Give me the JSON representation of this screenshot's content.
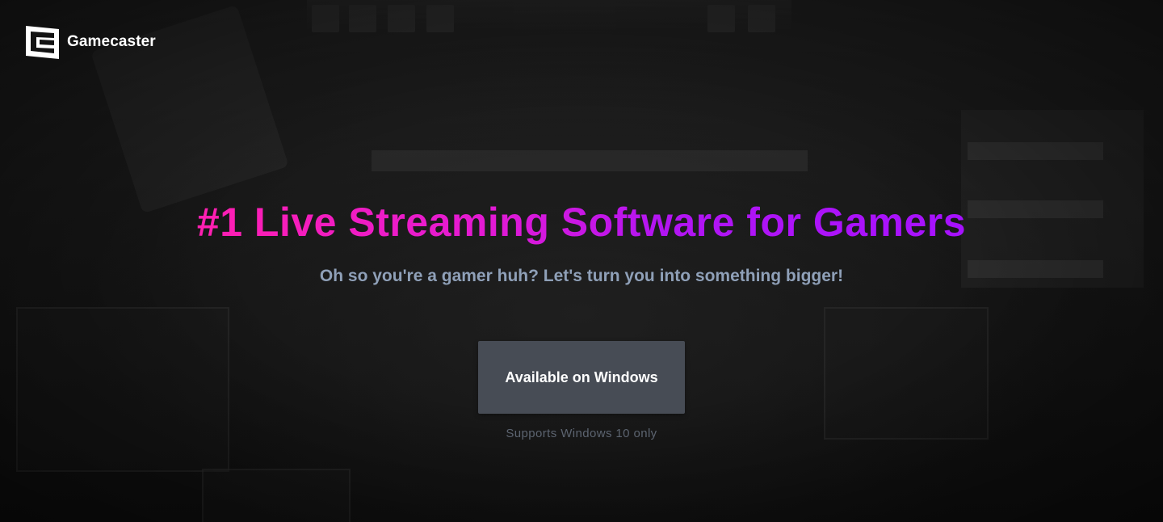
{
  "header": {
    "brand_name": "Gamecaster",
    "logo_icon": "gamecaster-logo-icon"
  },
  "hero": {
    "headline": "#1 Live Streaming Software for Gamers",
    "subheadline": "Oh so you're a gamer huh? Let's turn you into something bigger!",
    "cta_label": "Available on Windows",
    "support_note": "Supports Windows 10 only"
  },
  "colors": {
    "headline_gradient_start": "#ff1fb0",
    "headline_gradient_end": "#a611ff",
    "subheadline": "#8fa0b8",
    "cta_background": "#474c55",
    "note": "#5c6470",
    "background": "#121212"
  }
}
